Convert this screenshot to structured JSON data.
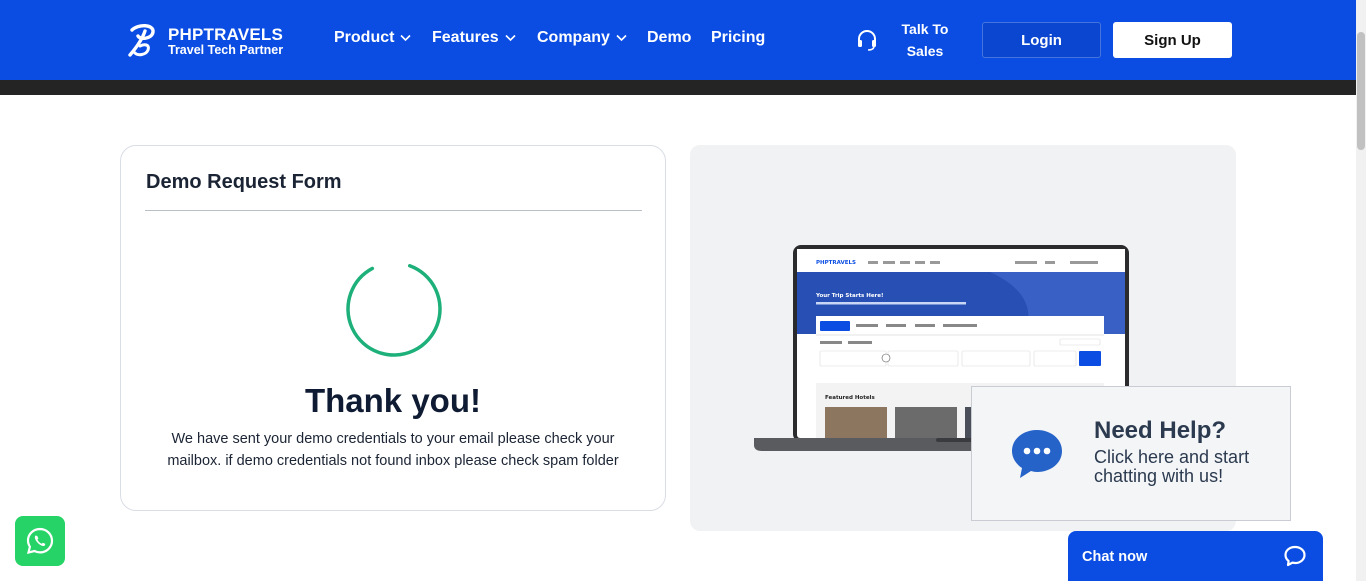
{
  "brand": {
    "name": "PHPTRAVELS",
    "tagline": "Travel Tech Partner",
    "accent": "#0b4de3"
  },
  "nav": {
    "items": [
      {
        "label": "Product",
        "dropdown": true
      },
      {
        "label": "Features",
        "dropdown": true
      },
      {
        "label": "Company",
        "dropdown": true
      },
      {
        "label": "Demo",
        "dropdown": false
      },
      {
        "label": "Pricing",
        "dropdown": false
      }
    ],
    "talk_line1": "Talk To",
    "talk_line2": "Sales",
    "login": "Login",
    "signup": "Sign Up"
  },
  "form": {
    "title": "Demo Request Form",
    "thanks": "Thank you!",
    "message": "We have sent your demo credentials to your email please check your mailbox. if demo credentials not found inbox please check spam folder",
    "spinner_color": "#1db07a"
  },
  "preview": {
    "screen_brand": "PHPTRAVELS",
    "hero_title": "Your Trip Starts Here!",
    "featured": "Featured Hotels"
  },
  "help": {
    "title": "Need Help?",
    "subtitle": "Click here and start chatting with us!"
  },
  "chat": {
    "label": "Chat now"
  },
  "icons": {
    "logo": "phptravels-logo-icon",
    "headset": "headset-icon",
    "chevron": "chevron-down-icon",
    "chat_bubble": "chat-bubble-icon",
    "whatsapp": "whatsapp-icon"
  }
}
